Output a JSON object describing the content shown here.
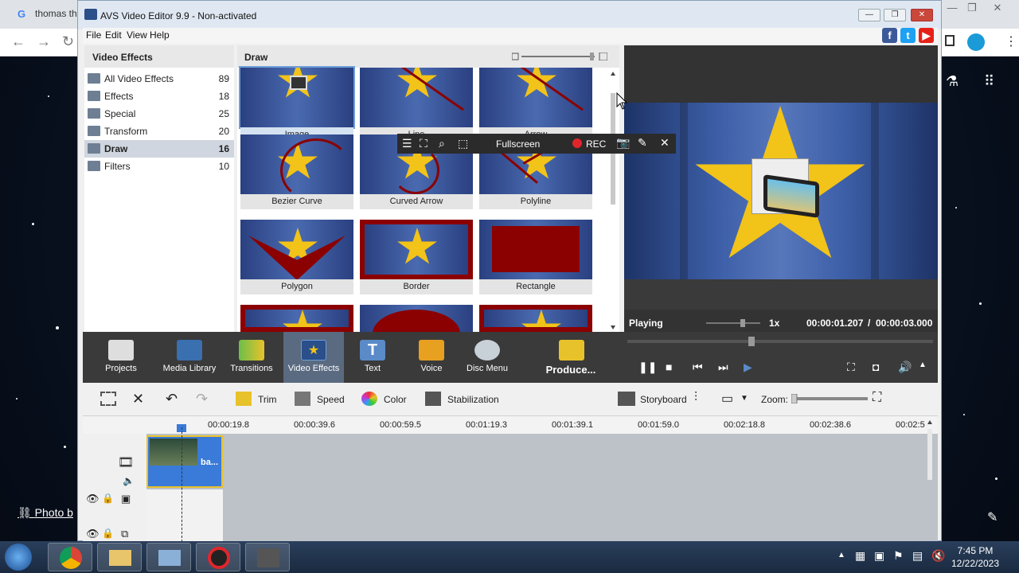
{
  "browser": {
    "tab_text": "thomas th",
    "photo_link": "Photo b"
  },
  "window": {
    "title": "AVS Video Editor 9.9 - Non-activated"
  },
  "menu": [
    "File",
    "Edit",
    "View",
    "Help"
  ],
  "left_panel": {
    "heading": "Video Effects",
    "categories": [
      {
        "name": "All Video Effects",
        "count": "89"
      },
      {
        "name": "Effects",
        "count": "18"
      },
      {
        "name": "Special",
        "count": "25"
      },
      {
        "name": "Transform",
        "count": "20"
      },
      {
        "name": "Draw",
        "count": "16"
      },
      {
        "name": "Filters",
        "count": "10"
      }
    ]
  },
  "grid_panel": {
    "heading": "Draw",
    "effects": [
      "Image",
      "Line",
      "Arrow",
      "Bezier Curve",
      "Curved Arrow",
      "Polyline",
      "Polygon",
      "Border",
      "Rectangle"
    ]
  },
  "rec_bar": {
    "fullscreen": "Fullscreen",
    "rec": "REC"
  },
  "preview": {
    "status": "Playing",
    "speed": "1x",
    "current_time": "00:00:01.207",
    "separator": "/",
    "total_time": "00:00:03.000"
  },
  "main_tools": [
    "Projects",
    "Media Library",
    "Transitions",
    "Video Effects",
    "Text",
    "Voice",
    "Disc Menu",
    "Produce..."
  ],
  "edit_toolbar": {
    "trim": "Trim",
    "speed": "Speed",
    "color": "Color",
    "stabilization": "Stabilization",
    "storyboard": "Storyboard",
    "zoom": "Zoom:"
  },
  "timeline": {
    "ticks": [
      "00:00:19.8",
      "00:00:39.6",
      "00:00:59.5",
      "00:01:19.3",
      "00:01:39.1",
      "00:01:59.0",
      "00:02:18.8",
      "00:02:38.6",
      "00:02:5"
    ],
    "clip_name": "ba..."
  },
  "taskbar": {
    "time": "7:45 PM",
    "date": "12/22/2023"
  },
  "colors": {
    "accent_blue": "#3a7ad8",
    "star_yellow": "#f2c318",
    "rec_red": "#e0262b",
    "toolbar_dark": "#3a3a3a"
  }
}
